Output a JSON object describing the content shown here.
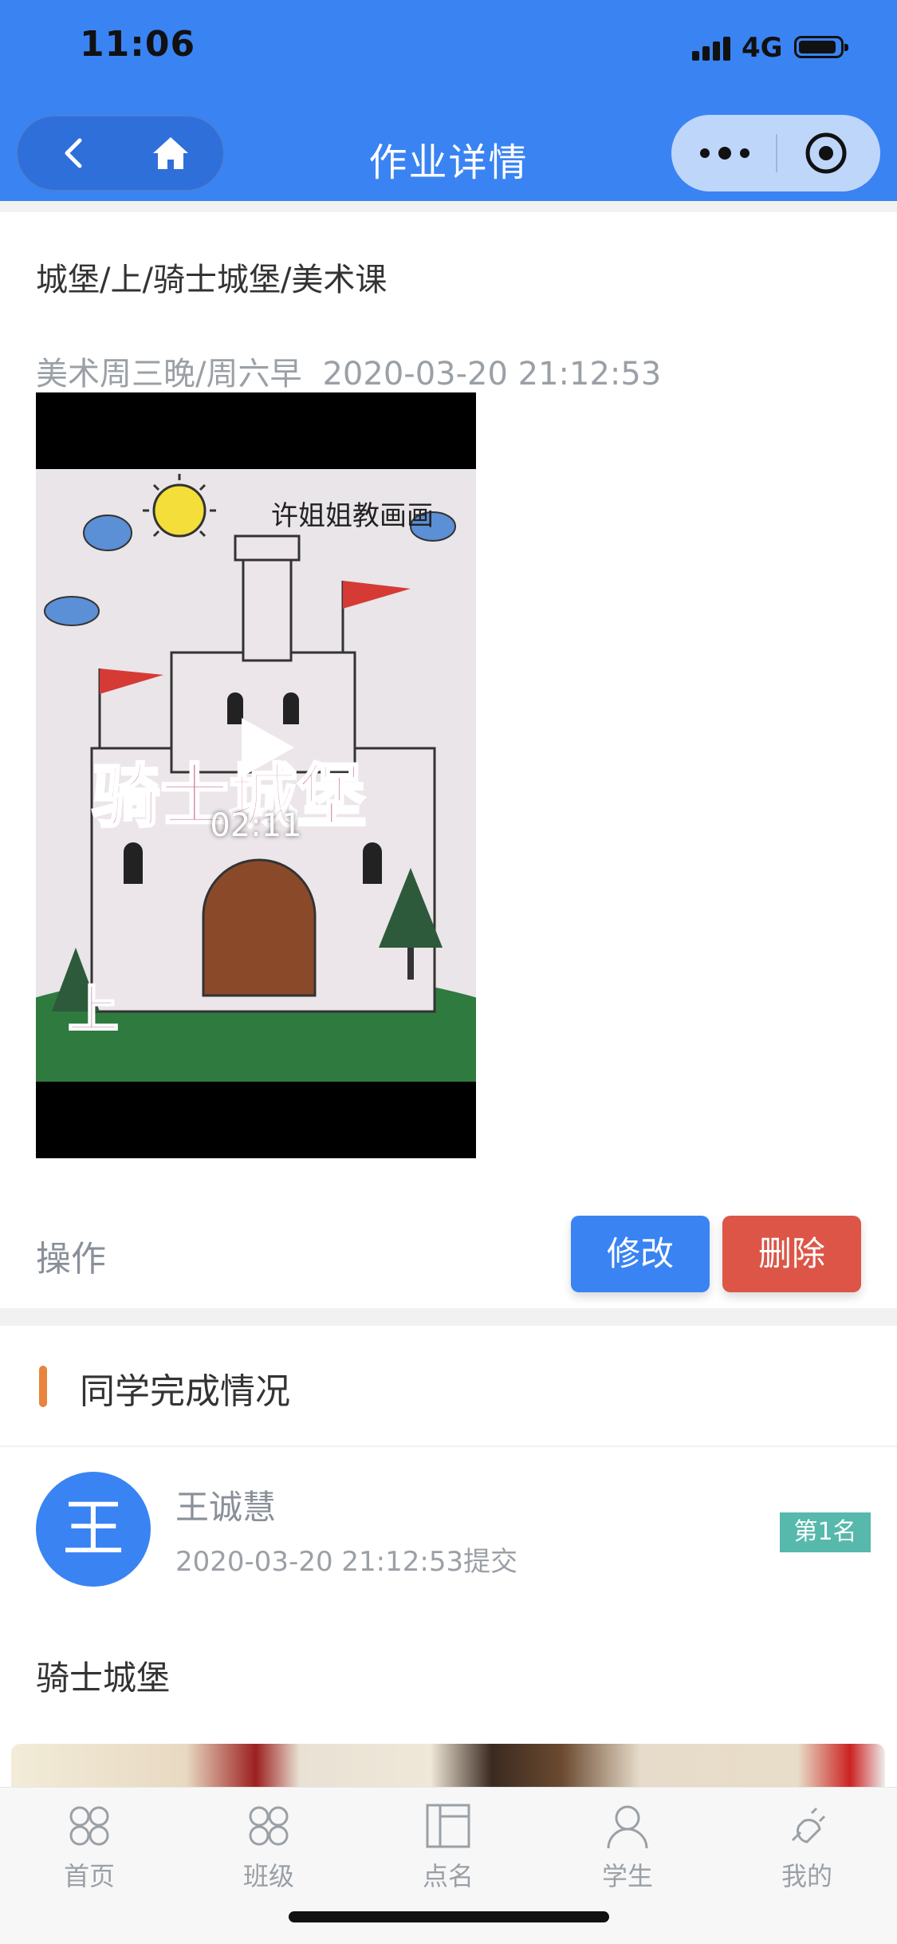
{
  "status_bar": {
    "time": "11:06",
    "network": "4G"
  },
  "nav": {
    "title": "作业详情"
  },
  "homework": {
    "title": "城堡/上/骑士城堡/美术课",
    "class_name": "美术周三晚/周六早",
    "datetime": "2020-03-20 21:12:53",
    "video": {
      "duration": "02:11",
      "overlay_caption": "许姐姐教画画",
      "overlay_title": "骑士城堡",
      "overlay_part": "上"
    }
  },
  "operations": {
    "label": "操作",
    "edit_label": "修改",
    "delete_label": "删除"
  },
  "completion": {
    "section_title": "同学完成情况",
    "student": {
      "avatar_char": "王",
      "name": "王诚慧",
      "submitted": "2020-03-20 21:12:53提交",
      "rank": "第1名"
    },
    "submission_title": "骑士城堡"
  },
  "tabbar": {
    "items": [
      {
        "label": "首页",
        "icon": "home-grid-icon"
      },
      {
        "label": "班级",
        "icon": "class-grid-icon"
      },
      {
        "label": "点名",
        "icon": "roll-call-icon"
      },
      {
        "label": "学生",
        "icon": "student-icon"
      },
      {
        "label": "我的",
        "icon": "plug-icon"
      }
    ]
  },
  "colors": {
    "header": "#3a83f3",
    "edit": "#3a83f3",
    "delete": "#dc5547",
    "accent_bar": "#e8843c",
    "rank_badge": "#57b8ac"
  }
}
